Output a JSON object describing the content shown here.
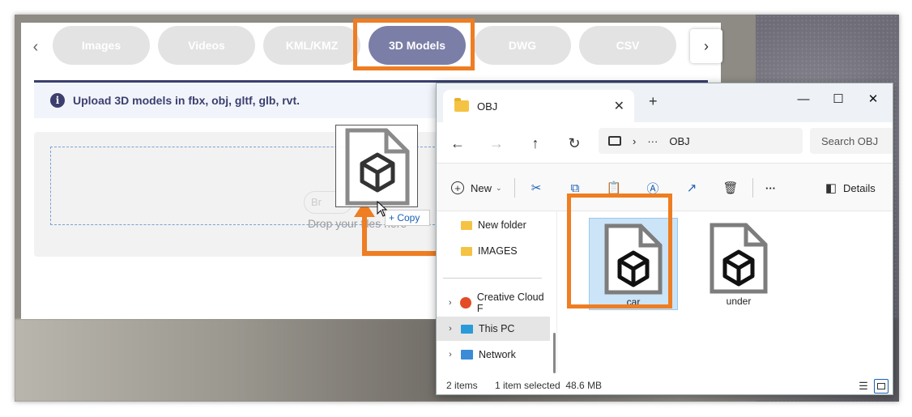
{
  "webpage": {
    "tabs": [
      {
        "label": "Images",
        "active": false
      },
      {
        "label": "Videos",
        "active": false
      },
      {
        "label": "KML/KMZ",
        "active": false
      },
      {
        "label": "3D Models",
        "active": true
      },
      {
        "label": "DWG",
        "active": false
      },
      {
        "label": "CSV",
        "active": false
      }
    ],
    "info_text": "Upload 3D models in fbx, obj, gltf, glb, rvt.",
    "drop_text": "Drop your files here",
    "browse_ghost": "Br",
    "drag_badge": "+ Copy"
  },
  "explorer": {
    "tab_title": "OBJ",
    "address": {
      "ellipsis": "···",
      "folder": "OBJ"
    },
    "search_placeholder": "Search OBJ",
    "commands": {
      "new": "New",
      "details": "Details"
    },
    "nav_items": [
      {
        "label": "New folder",
        "icon": "folder-icon"
      },
      {
        "label": "IMAGES",
        "icon": "folder-icon"
      },
      {
        "label": "Creative Cloud F",
        "icon": "creative-cloud-icon"
      },
      {
        "label": "This PC",
        "icon": "pc-icon",
        "selected": true
      },
      {
        "label": "Network",
        "icon": "network-icon"
      }
    ],
    "files": [
      {
        "label": "car",
        "selected": true,
        "icon": "3d-model-file-icon"
      },
      {
        "label": "under",
        "selected": false,
        "icon": "3d-model-file-icon"
      }
    ],
    "status": {
      "count": "2 items",
      "selection": "1 item selected  48.6 MB"
    }
  },
  "colors": {
    "highlight": "#ef7d22",
    "active_tab": "#7b7fa7",
    "info_text": "#3c3f6e",
    "selection": "#cce4f7"
  }
}
